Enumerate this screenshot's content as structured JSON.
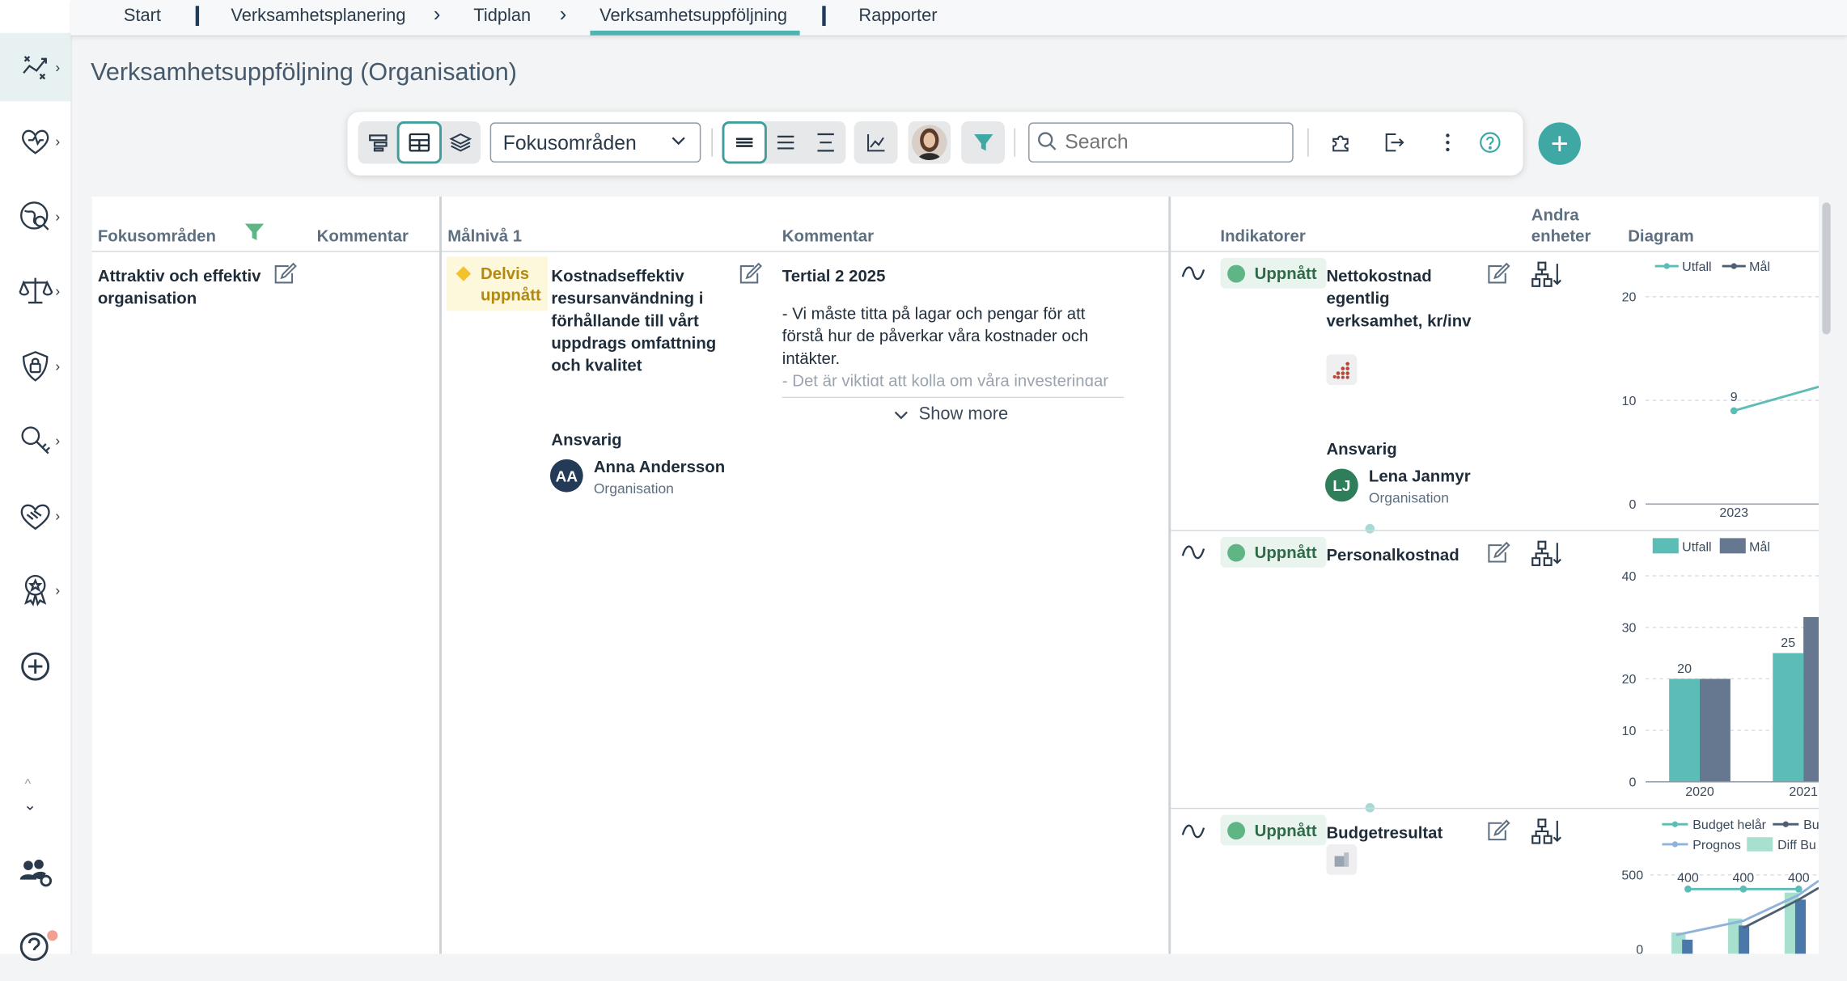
{
  "nav": {
    "items": [
      {
        "label": "Start"
      },
      {
        "label": "Verksamhetsplanering"
      },
      {
        "label": "Tidplan"
      },
      {
        "label": "Verksamhetsuppföljning"
      },
      {
        "label": "Rapporter"
      }
    ]
  },
  "page": {
    "title": "Verksamhetsuppföljning (Organisation)"
  },
  "toolbar": {
    "dropdown_value": "Fokusområden",
    "search_placeholder": "Search"
  },
  "left_panel": {
    "headers": {
      "focus": "Fokusområden",
      "comment": "Kommentar"
    },
    "focus_area": "Attraktiv och effektiv organisation"
  },
  "middle_panel": {
    "headers": {
      "goal": "Målnivå 1",
      "comment": "Kommentar"
    },
    "status": "Delvis uppnått",
    "goal_text": "Kostnadseffektiv resursanvändning i förhållande till vårt uppdrags omfattning och kvalitet",
    "responsible_label": "Ansvarig",
    "responsible": {
      "initials": "AA",
      "name": "Anna Andersson",
      "unit": "Organisation"
    },
    "comment_title": "Tertial 2 2025",
    "comment_lines": [
      "- Vi måste titta på lagar och pengar för att",
      "förstå hur de påverkar våra kostnader och",
      "intäkter.",
      "- Det är viktigt att kolla om våra investeringar"
    ],
    "show_more": "Show more"
  },
  "right_panel": {
    "headers": {
      "indicators": "Indikatorer",
      "other_units_1": "Andra",
      "other_units_2": "enheter",
      "diagram": "Diagram"
    },
    "indicators": [
      {
        "status": "Uppnått",
        "name": "Nettokostnad egentlig verksamhet, kr/inv",
        "responsible_label": "Ansvarig",
        "responsible": {
          "initials": "LJ",
          "name": "Lena Janmyr",
          "unit": "Organisation"
        }
      },
      {
        "status": "Uppnått",
        "name": "Personalkostnad"
      },
      {
        "status": "Uppnått",
        "name": "Budgetresultat"
      }
    ]
  },
  "chart_data": [
    {
      "type": "line",
      "legend": [
        "Utfall",
        "Mål"
      ],
      "x": [
        "2023"
      ],
      "series": [
        {
          "name": "Utfall",
          "values": [
            9,
            11.5
          ]
        }
      ],
      "data_labels": [
        "9"
      ],
      "y_ticks": [
        "0",
        "10",
        "20"
      ],
      "ylim": [
        0,
        20
      ],
      "colors": {
        "Utfall": "#5cbcb6",
        "Mål": "#4f5f73"
      }
    },
    {
      "type": "bar",
      "legend": [
        "Utfall",
        "Mål"
      ],
      "categories": [
        "2020",
        "2021"
      ],
      "series": [
        {
          "name": "Utfall",
          "values": [
            20,
            25
          ]
        },
        {
          "name": "Mål",
          "values": [
            20,
            32
          ]
        }
      ],
      "data_labels": [
        "20",
        "25"
      ],
      "y_ticks": [
        "0",
        "10",
        "20",
        "30",
        "40"
      ],
      "ylim": [
        0,
        40
      ],
      "colors": {
        "Utfall": "#5cbcb6",
        "Mål": "#66788f"
      }
    },
    {
      "type": "line",
      "legend": [
        "Budget helår",
        "Bu",
        "Prognos",
        "Diff Bu"
      ],
      "series": [
        {
          "name": "Budget helår",
          "values": [
            400,
            400,
            400
          ]
        }
      ],
      "data_labels": [
        "400",
        "400",
        "400"
      ],
      "y_ticks": [
        "500",
        "0"
      ],
      "colors": {
        "Budget helår": "#5cbcb6",
        "Bu": "#4f5f73",
        "Prognos": "#8fb3d9",
        "Diff Bu": "#a8e0cf"
      }
    }
  ]
}
